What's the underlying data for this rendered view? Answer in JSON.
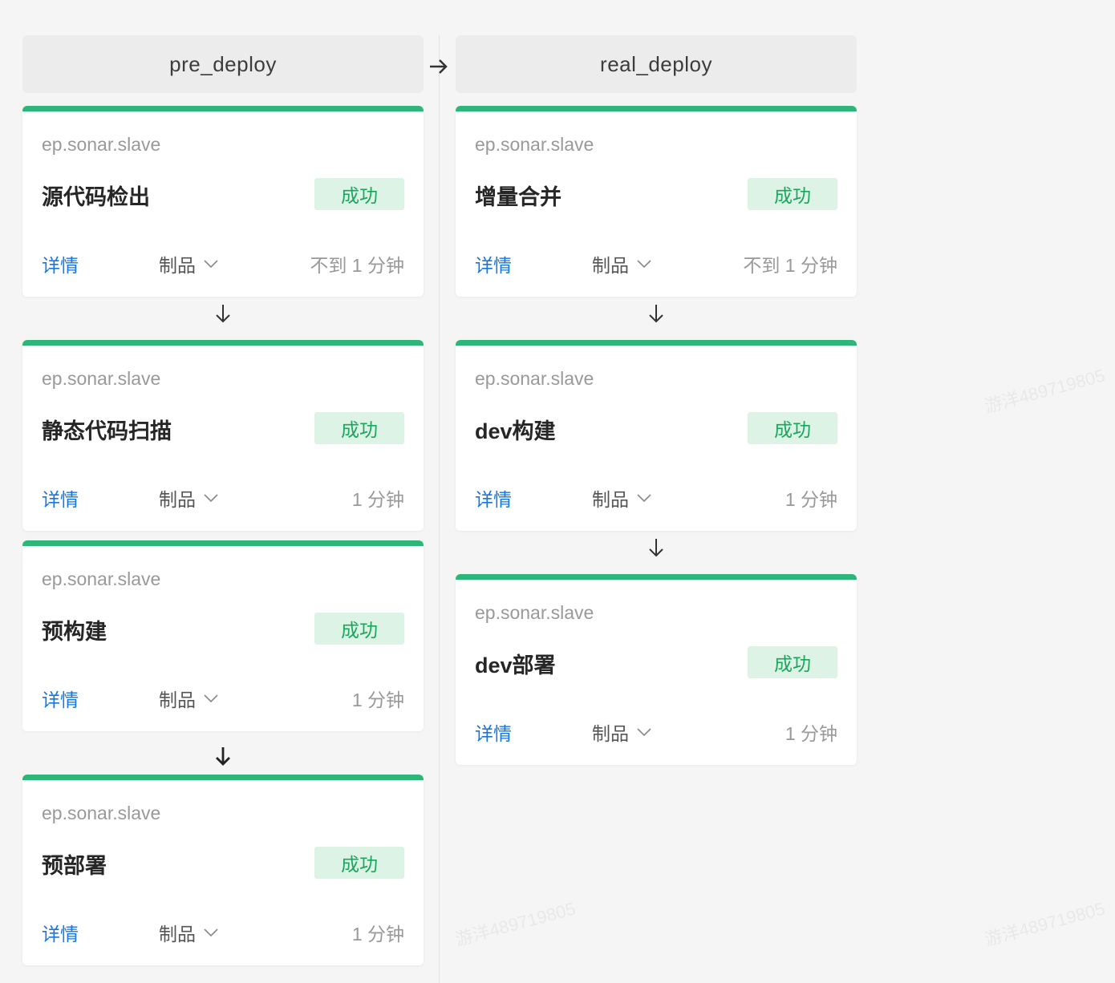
{
  "watermark": "游洋489719805",
  "stages": [
    {
      "name": "pre_deploy",
      "jobs": [
        {
          "node": "ep.sonar.slave",
          "title": "源代码检出",
          "status": "成功",
          "detail": "详情",
          "artifact": "制品",
          "duration": "不到 1 分钟"
        },
        {
          "node": "ep.sonar.slave",
          "title": "静态代码扫描",
          "status": "成功",
          "detail": "详情",
          "artifact": "制品",
          "duration": "1 分钟"
        },
        {
          "node": "ep.sonar.slave",
          "title": "预构建",
          "status": "成功",
          "detail": "详情",
          "artifact": "制品",
          "duration": "1 分钟"
        },
        {
          "node": "ep.sonar.slave",
          "title": "预部署",
          "status": "成功",
          "detail": "详情",
          "artifact": "制品",
          "duration": "1 分钟"
        }
      ]
    },
    {
      "name": "real_deploy",
      "jobs": [
        {
          "node": "ep.sonar.slave",
          "title": "增量合并",
          "status": "成功",
          "detail": "详情",
          "artifact": "制品",
          "duration": "不到 1 分钟"
        },
        {
          "node": "ep.sonar.slave",
          "title": "dev构建",
          "status": "成功",
          "detail": "详情",
          "artifact": "制品",
          "duration": "1 分钟"
        },
        {
          "node": "ep.sonar.slave",
          "title": "dev部署",
          "status": "成功",
          "detail": "详情",
          "artifact": "制品",
          "duration": "1 分钟"
        }
      ]
    }
  ],
  "colors": {
    "success_bar": "#2eb67a",
    "success_bg": "#dcf3e6",
    "success_text": "#1aa65c",
    "link": "#1677e0"
  }
}
